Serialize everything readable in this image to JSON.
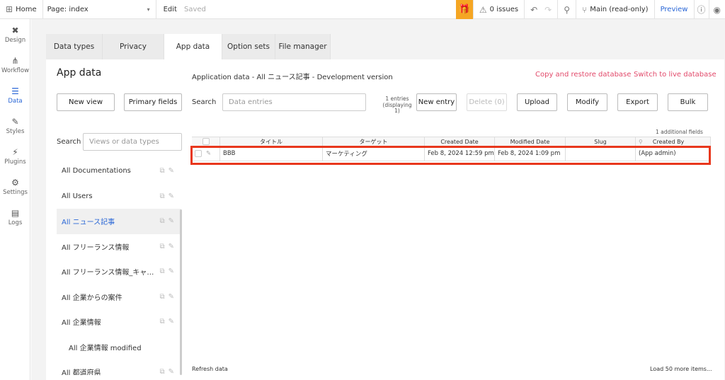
{
  "topbar": {
    "home_label": "Home",
    "page_label": "Page: index",
    "edit_label": "Edit",
    "saved_label": "Saved",
    "issues_label": "0 issues",
    "branch_label": "Main (read-only)",
    "preview_label": "Preview"
  },
  "leftnav": {
    "items": [
      {
        "label": "Design"
      },
      {
        "label": "Workflow"
      },
      {
        "label": "Data"
      },
      {
        "label": "Styles"
      },
      {
        "label": "Plugins"
      },
      {
        "label": "Settings"
      },
      {
        "label": "Logs"
      }
    ]
  },
  "tabs": [
    "Data types",
    "Privacy",
    "App data",
    "Option sets",
    "File manager"
  ],
  "left": {
    "title": "App data",
    "new_view": "New view",
    "primary_fields": "Primary fields",
    "search_label": "Search",
    "search_placeholder": "Views or data types",
    "types": [
      "All Documentations",
      "All Users",
      "All ニュース記事",
      "All フリーランス情報",
      "All フリーランス情報_キャ…",
      "All 企業からの案件",
      "All 企業情報",
      "All 企業情報 modified",
      "All 都道府県"
    ]
  },
  "right": {
    "subtitle": "Application data - All ニュース記事 - Development version",
    "copy_restore": "Copy and restore database",
    "switch_live": "Switch to live database",
    "search_label": "Search",
    "search_placeholder": "Data entries",
    "entries_info": "1 entries (displaying 1)",
    "buttons": {
      "new_entry": "New entry",
      "delete": "Delete (0)",
      "upload": "Upload",
      "modify": "Modify",
      "export": "Export",
      "bulk": "Bulk"
    },
    "additional_fields": "1 additional fields",
    "table": {
      "headers": [
        "タイトル",
        "ターゲット",
        "Created Date",
        "Modified Date",
        "Slug",
        "Created By"
      ],
      "rows": [
        [
          "BBB",
          "マーケティング",
          "Feb 8, 2024 12:59 pm",
          "Feb 8, 2024 1:09 pm",
          "",
          "(App admin)"
        ]
      ]
    },
    "refresh": "Refresh data",
    "load_more": "Load 50 more items..."
  },
  "colors": {
    "accent": "#2966d6",
    "pink_link": "#e24a6b",
    "highlight": "#e8371d",
    "gift": "#f5a623"
  }
}
